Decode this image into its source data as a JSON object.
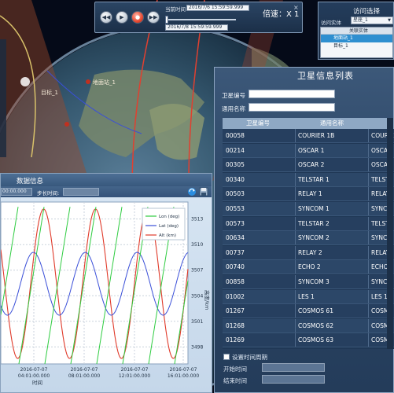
{
  "playback": {
    "current_time_label": "当前时间",
    "current_time": "2016/7/6 15:59:59.999",
    "end_time": "2016/7/8 15:59:59.999",
    "speed_text": "倍速：X 1",
    "buttons": [
      "rewind",
      "play",
      "record",
      "fast-forward"
    ]
  },
  "access": {
    "title": "访问选择",
    "select_label": "访问实体",
    "selected": "星座_1",
    "list_header": "关联实体",
    "items": [
      {
        "label": "地面站_1",
        "selected": true
      },
      {
        "label": "目标_1",
        "selected": false
      }
    ]
  },
  "globe": {
    "labels": [
      "目标_1",
      "地面站_1"
    ]
  },
  "satellites": {
    "title": "卫星信息列表",
    "id_label": "卫星编号",
    "name_label": "通用名称",
    "columns": [
      "卫星编号",
      "通用名称",
      ""
    ],
    "rows": [
      [
        "00058",
        "COURIER 1B",
        "COURIE"
      ],
      [
        "00214",
        "OSCAR 1",
        "OSCAR"
      ],
      [
        "00305",
        "OSCAR 2",
        "OSCAR"
      ],
      [
        "00340",
        "TELSTAR 1",
        "TELSTA"
      ],
      [
        "00503",
        "RELAY 1",
        "RELAY"
      ],
      [
        "00553",
        "SYNCOM 1",
        "SYNCO"
      ],
      [
        "00573",
        "TELSTAR 2",
        "TELSTA"
      ],
      [
        "00634",
        "SYNCOM 2",
        "SYNCO"
      ],
      [
        "00737",
        "RELAY 2",
        "RELAY"
      ],
      [
        "00740",
        "ECHO 2",
        "ECHO"
      ],
      [
        "00858",
        "SYNCOM 3",
        "SYNCO"
      ],
      [
        "01002",
        "LES 1",
        "LES 1"
      ],
      [
        "01267",
        "COSMOS 61",
        "COSM"
      ],
      [
        "01268",
        "COSMOS 62",
        "COSM"
      ],
      [
        "01269",
        "COSMOS 63",
        "COSM"
      ]
    ],
    "set_time_label": "设置时间周期",
    "start_label": "开始时间",
    "end_label": "结束时间"
  },
  "data_panel": {
    "title": "数据信息",
    "start_value": "00:00.000",
    "step_label": "步长时间:"
  },
  "chart_data": {
    "type": "line",
    "title": "",
    "xlabel": "时间",
    "ylabel": "高度/km",
    "x_ticks": [
      "2016-07-07\n04:01:00.000",
      "2016-07-07\n08:01:00.000",
      "2016-07-07\n12:01:00.000",
      "2016-07-07\n16:01:00.000"
    ],
    "y_ticks": [
      3498,
      3501,
      3504,
      3507,
      3510,
      3513
    ],
    "ylim": [
      3496,
      3515
    ],
    "legend": [
      "Lon (deg)",
      "Lat (deg)",
      "Alt (km)"
    ],
    "legend_position": "top-right",
    "grid": true,
    "series": [
      {
        "name": "Lon (deg)",
        "color": "#2ecc40",
        "style": "sawtooth"
      },
      {
        "name": "Lat (deg)",
        "color": "#3a4fd8",
        "style": "sine"
      },
      {
        "name": "Alt (km)",
        "color": "#e03a2a",
        "style": "sine"
      }
    ]
  }
}
